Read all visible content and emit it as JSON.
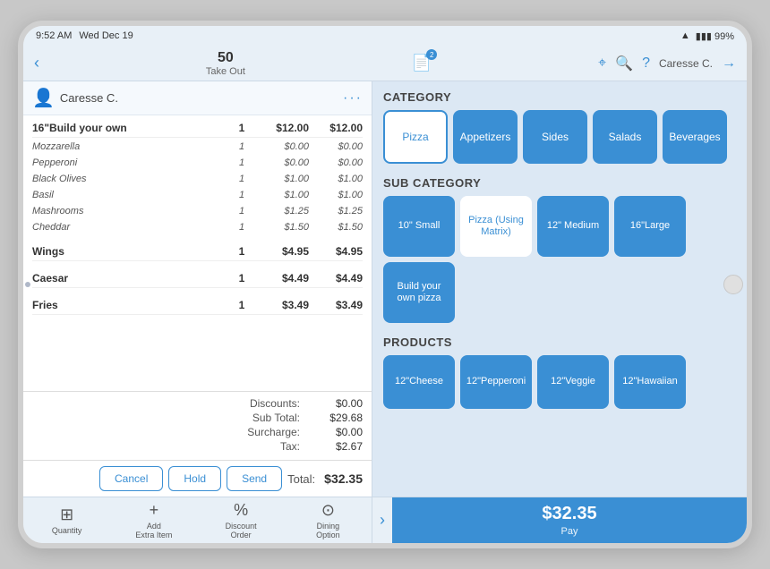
{
  "status_bar": {
    "time": "9:52 AM",
    "date": "Wed Dec 19",
    "wifi_icon": "wifi",
    "battery": "99%"
  },
  "top_nav": {
    "back_label": "‹",
    "order_number": "50",
    "order_type": "Take Out",
    "badge_count": "2",
    "search_icon": "search",
    "help_icon": "?",
    "user_name": "Caresse C.",
    "logout_icon": "logout"
  },
  "order": {
    "customer_name": "Caresse C.",
    "items": [
      {
        "name": "16\"Build your own",
        "qty": "1",
        "price": "$12.00",
        "total": "$12.00",
        "type": "main"
      },
      {
        "name": "Mozzarella",
        "qty": "1",
        "price": "$0.00",
        "total": "$0.00",
        "type": "sub"
      },
      {
        "name": "Pepperoni",
        "qty": "1",
        "price": "$0.00",
        "total": "$0.00",
        "type": "sub"
      },
      {
        "name": "Black Olives",
        "qty": "1",
        "price": "$1.00",
        "total": "$1.00",
        "type": "sub"
      },
      {
        "name": "Basil",
        "qty": "1",
        "price": "$1.00",
        "total": "$1.00",
        "type": "sub"
      },
      {
        "name": "Mashrooms",
        "qty": "1",
        "price": "$1.25",
        "total": "$1.25",
        "type": "sub"
      },
      {
        "name": "Cheddar",
        "qty": "1",
        "price": "$1.50",
        "total": "$1.50",
        "type": "sub"
      },
      {
        "name": "Wings",
        "qty": "1",
        "price": "$4.95",
        "total": "$4.95",
        "type": "main"
      },
      {
        "name": "Caesar",
        "qty": "1",
        "price": "$4.49",
        "total": "$4.49",
        "type": "main"
      },
      {
        "name": "Fries",
        "qty": "1",
        "price": "$3.49",
        "total": "$3.49",
        "type": "main"
      }
    ],
    "discounts_label": "Discounts:",
    "discounts_value": "$0.00",
    "subtotal_label": "Sub Total:",
    "subtotal_value": "$29.68",
    "surcharge_label": "Surcharge:",
    "surcharge_value": "$0.00",
    "tax_label": "Tax:",
    "tax_value": "$2.67",
    "total_label": "Total:",
    "total_value": "$32.35"
  },
  "action_buttons": {
    "cancel": "Cancel",
    "hold": "Hold",
    "send": "Send"
  },
  "bottom_toolbar": {
    "items": [
      {
        "icon": "⊞",
        "label": "Quantity"
      },
      {
        "icon": "+",
        "label": "Add\nExtra Item"
      },
      {
        "icon": "%",
        "label": "Discount\nOrder"
      },
      {
        "icon": "⊙",
        "label": "Dining\nOption"
      }
    ],
    "pay_amount": "$32.35",
    "pay_label": "Pay"
  },
  "menu": {
    "category_title": "CATEGORY",
    "categories": [
      {
        "label": "Pizza",
        "active": true
      },
      {
        "label": "Appetizers",
        "active": false
      },
      {
        "label": "Sides",
        "active": false
      },
      {
        "label": "Salads",
        "active": false
      },
      {
        "label": "Beverages",
        "active": false
      }
    ],
    "subcategory_title": "SUB CATEGORY",
    "subcategories": [
      {
        "label": "10\" Small",
        "active": false
      },
      {
        "label": "Pizza (Using Matrix)",
        "active": true
      },
      {
        "label": "12\" Medium",
        "active": false
      },
      {
        "label": "16\"Large",
        "active": false
      },
      {
        "label": "Build your own pizza",
        "active": false
      }
    ],
    "products_title": "PRODUCTS",
    "products": [
      {
        "label": "12\"Cheese"
      },
      {
        "label": "12\"Pepperoni"
      },
      {
        "label": "12\"Veggie"
      },
      {
        "label": "12\"Hawaiian"
      }
    ]
  }
}
